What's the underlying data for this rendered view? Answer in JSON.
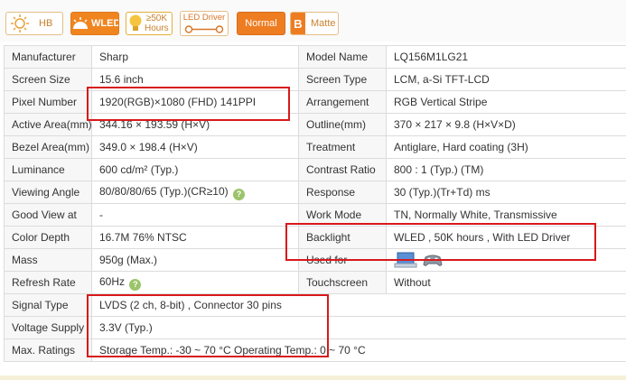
{
  "badges": {
    "hb": "HB",
    "wled": "WLED",
    "hours": "≥50K\nHours",
    "led_driver": "LED Driver",
    "normal": "Normal",
    "matte": "Matte",
    "matte_letter": "B"
  },
  "specs": {
    "left": [
      {
        "label": "Manufacturer",
        "value": "Sharp"
      },
      {
        "label": "Screen Size",
        "value": "15.6 inch"
      },
      {
        "label": "Pixel Number",
        "value": "1920(RGB)×1080   (FHD)  141PPI"
      },
      {
        "label": "Active Area(mm)",
        "value": "344.16 × 193.59 (H×V)"
      },
      {
        "label": "Bezel Area(mm)",
        "value": "349.0 × 198.4 (H×V)"
      },
      {
        "label": "Luminance",
        "value": "600 cd/m² (Typ.)"
      },
      {
        "label": "Viewing Angle",
        "value": "80/80/80/65 (Typ.)(CR≥10)"
      },
      {
        "label": "Good View at",
        "value": "-"
      },
      {
        "label": "Color Depth",
        "value": "16.7M   76% NTSC"
      },
      {
        "label": "Mass",
        "value": "950g (Max.)"
      },
      {
        "label": "Refresh Rate",
        "value": "60Hz"
      }
    ],
    "right": [
      {
        "label": "Model Name",
        "value": "LQ156M1LG21"
      },
      {
        "label": "Screen Type",
        "value": "LCM,   a-Si TFT-LCD"
      },
      {
        "label": "Arrangement",
        "value": "RGB Vertical Stripe"
      },
      {
        "label": "Outline(mm)",
        "value": "370 × 217 × 9.8 (H×V×D)"
      },
      {
        "label": "Treatment",
        "value": "Antiglare, Hard coating (3H)"
      },
      {
        "label": "Contrast Ratio",
        "value": "800 : 1 (Typ.) (TM)"
      },
      {
        "label": "Response",
        "value": "30 (Typ.)(Tr+Td) ms"
      },
      {
        "label": "Work Mode",
        "value": "TN, Normally White, Transmissive"
      },
      {
        "label": "Backlight",
        "value": "WLED , 50K hours , With LED Driver"
      },
      {
        "label": "Used for",
        "value": ""
      },
      {
        "label": "Touchscreen",
        "value": "Without"
      }
    ],
    "full": [
      {
        "label": "Signal Type",
        "value": "LVDS (2 ch, 8-bit) , Connector 30 pins"
      },
      {
        "label": "Voltage Supply",
        "value": "3.3V (Typ.)"
      },
      {
        "label": "Max. Ratings",
        "value": "Storage Temp.: -30 ~ 70 °C     Operating Temp.: 0 ~ 70 °C"
      }
    ]
  },
  "help_glyph": "?",
  "colors": {
    "highlight": "#d8191b",
    "badge_orange": "#ee7d22"
  }
}
